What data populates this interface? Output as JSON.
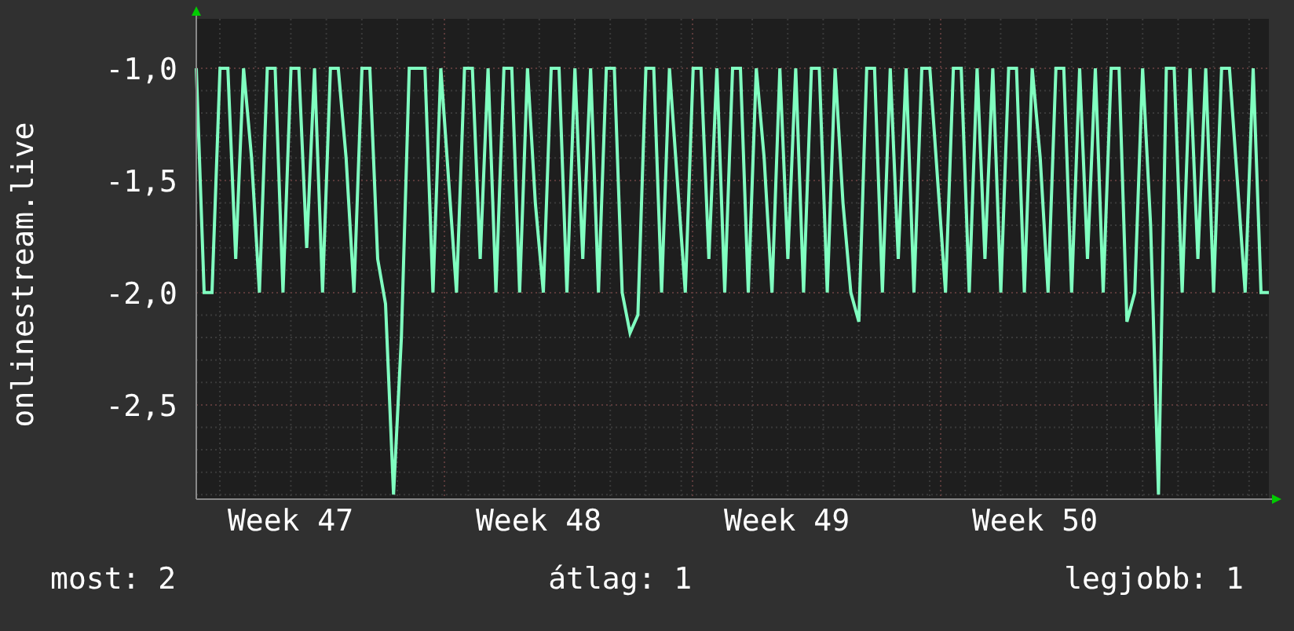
{
  "chart": {
    "week_labels": [
      "Week 47",
      "Week 48",
      "Week 49",
      "Week 50"
    ],
    "chart_data": {
      "type": "line",
      "grid": true,
      "ylabel": "onlinestream.live",
      "ylim": [
        -2.92,
        -0.78
      ],
      "yticks": [
        {
          "value": -1,
          "label": "-1,0"
        },
        {
          "value": -1.5,
          "label": "-1,5"
        },
        {
          "value": -2,
          "label": "-2,0"
        },
        {
          "value": -2.5,
          "label": "-2,5"
        }
      ],
      "series": [
        {
          "color": "#80ffc0",
          "values": [
            -1,
            -2,
            -2,
            -1,
            -1,
            -1.85,
            -1,
            -1.4,
            -2,
            -1,
            -1,
            -2,
            -1,
            -1,
            -1.8,
            -1,
            -2,
            -1,
            -1,
            -1.4,
            -2,
            -1,
            -1,
            -1.85,
            -2.05,
            -2.9,
            -2.2,
            -1,
            -1,
            -1,
            -2,
            -1,
            -1.5,
            -2,
            -1,
            -1,
            -1.85,
            -1,
            -2,
            -1,
            -1,
            -2,
            -1,
            -1.6,
            -2,
            -1,
            -1,
            -2,
            -1,
            -1.85,
            -1,
            -2,
            -1,
            -1,
            -2,
            -2.18,
            -2.1,
            -1,
            -1,
            -2,
            -1,
            -1.5,
            -2,
            -1,
            -1,
            -1.85,
            -1,
            -2,
            -1,
            -1,
            -2,
            -1,
            -1.4,
            -2,
            -1,
            -1.85,
            -1,
            -2,
            -1,
            -1,
            -2,
            -1,
            -1.6,
            -2,
            -2.13,
            -1,
            -1,
            -2,
            -1,
            -1.85,
            -1,
            -2,
            -1,
            -1,
            -1.5,
            -2,
            -1,
            -1,
            -2,
            -1,
            -1.85,
            -1,
            -2,
            -1,
            -1,
            -2,
            -1,
            -1.4,
            -2,
            -1,
            -1,
            -2,
            -1,
            -1.85,
            -1,
            -2,
            -1,
            -1,
            -2.13,
            -2,
            -1,
            -1.7,
            -2.9,
            -1,
            -1,
            -2,
            -1,
            -1.85,
            -1,
            -2,
            -1,
            -1,
            -1.5,
            -2,
            -1,
            -2,
            -2
          ]
        }
      ]
    }
  },
  "legend": [
    {
      "label": "most: 2"
    },
    {
      "label": "átlag: 1"
    },
    {
      "label": "legjobb: 1"
    }
  ]
}
